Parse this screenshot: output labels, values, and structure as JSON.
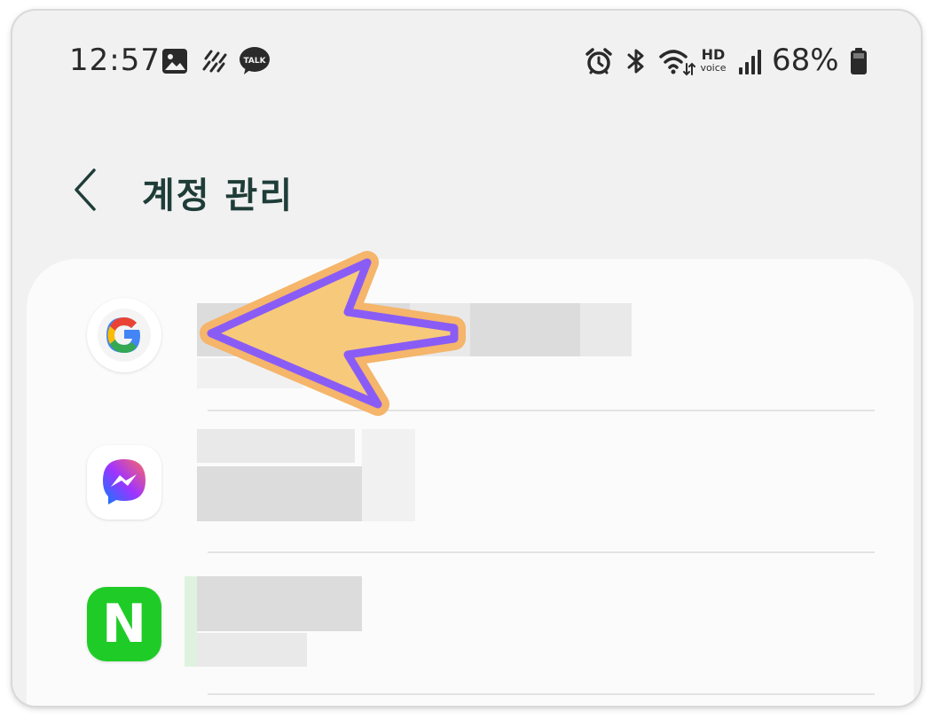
{
  "status_bar": {
    "time": "12:57",
    "notification_icons": [
      "gallery-icon",
      "weather-icon",
      "kakaotalk-icon"
    ],
    "kakaotalk_label": "TALK",
    "system_icons": [
      "alarm-icon",
      "bluetooth-icon",
      "wifi-icon",
      "hd-voice-icon",
      "signal-icon",
      "battery-icon"
    ],
    "hd_label": "HD",
    "voice_label": "voice",
    "battery": "68%"
  },
  "header": {
    "back_icon": "chevron-left-icon",
    "title": "계정 관리"
  },
  "accounts": [
    {
      "app": "Google",
      "icon": "google-icon",
      "name_redacted": true
    },
    {
      "app": "Messenger",
      "icon": "messenger-icon",
      "name_redacted": true
    },
    {
      "app": "Naver",
      "icon": "naver-icon",
      "icon_letter": "N",
      "name_redacted": true
    }
  ],
  "annotation": {
    "type": "arrow",
    "fill": "#F7C97A",
    "stroke": "#8A5CF6",
    "outline": "#F5B56A",
    "points_to": "accounts.0"
  },
  "colors": {
    "background": "#F1F1F1",
    "card": "#FBFBFB",
    "title": "#1F3D38",
    "naver_green": "#1FCC27"
  }
}
